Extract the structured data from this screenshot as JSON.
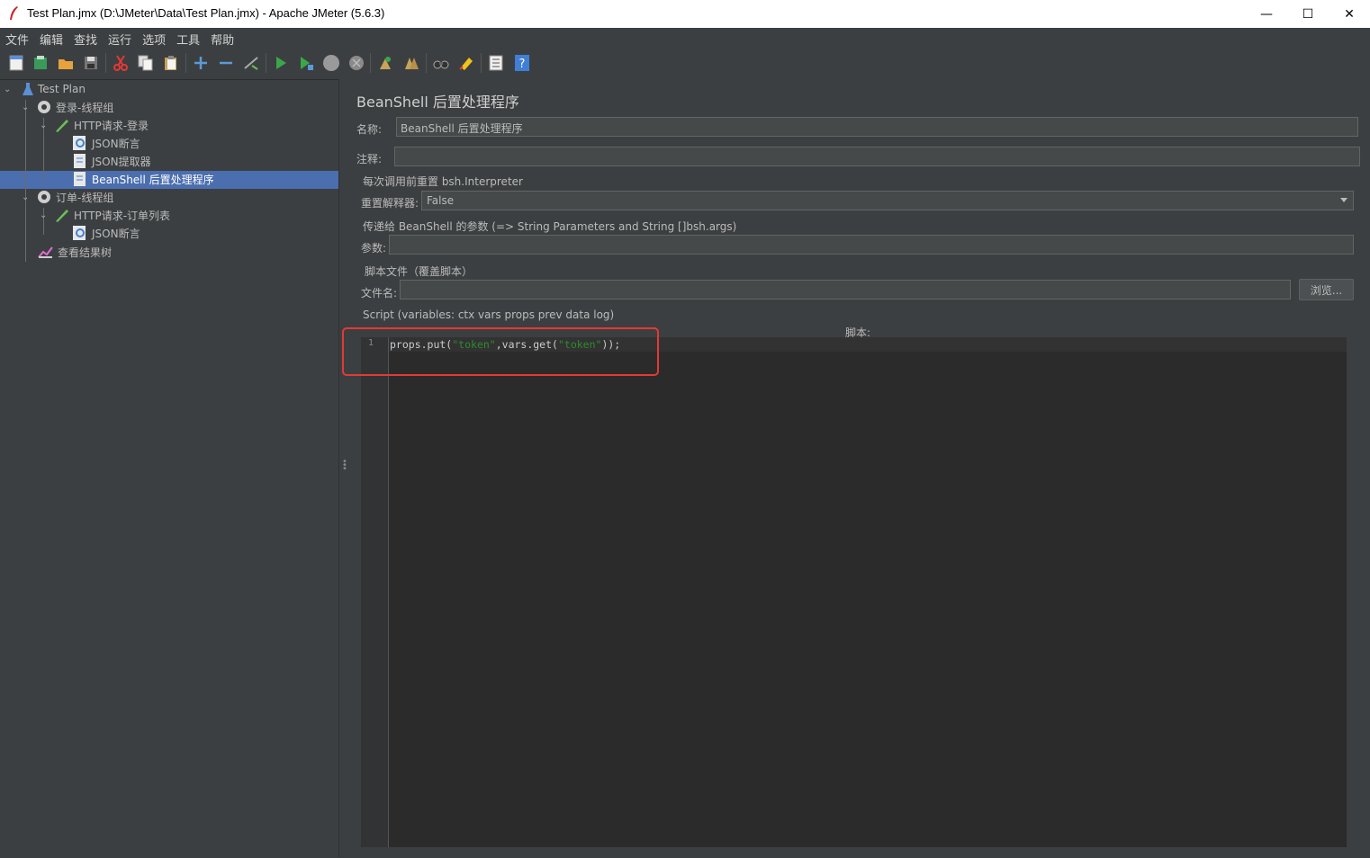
{
  "window": {
    "title": "Test Plan.jmx (D:\\JMeter\\Data\\Test Plan.jmx) - Apache JMeter (5.6.3)",
    "minimize": "—",
    "maximize": "☐",
    "close": "✕"
  },
  "menu": [
    "文件",
    "编辑",
    "查找",
    "运行",
    "选项",
    "工具",
    "帮助"
  ],
  "tree": {
    "test_plan": "Test Plan",
    "login_group": "登录-线程组",
    "http_login": "HTTP请求-登录",
    "json_assert_1": "JSON断言",
    "json_extractor": "JSON提取器",
    "beanshell": "BeanShell 后置处理程序",
    "order_group": "订单-线程组",
    "http_orders": "HTTP请求-订单列表",
    "json_assert_2": "JSON断言",
    "result_tree": "查看结果树"
  },
  "panel": {
    "heading": "BeanShell 后置处理程序",
    "name_label": "名称:",
    "name_value": "BeanShell 后置处理程序",
    "comment_label": "注释:",
    "comment_value": "",
    "reset_group": "每次调用前重置 bsh.Interpreter",
    "reset_label": "重置解释器:",
    "reset_value": "False",
    "params_group": "传递给 BeanShell 的参数 (=> String Parameters and String []bsh.args)",
    "params_label": "参数:",
    "params_value": "",
    "file_group": "脚本文件（覆盖脚本）",
    "file_label": "文件名:",
    "file_value": "",
    "browse_button": "浏览...",
    "script_group": "Script (variables: ctx vars props prev data log)",
    "script_label": "脚本:"
  },
  "editor": {
    "line_number": "1",
    "code_1": "props.put(",
    "str_1": "\"token\"",
    "code_2": ",vars.get(",
    "str_2": "\"token\"",
    "code_3": "));"
  },
  "colors": {
    "background": "#3c3f41",
    "selection": "#4b6eaf",
    "editor_bg": "#2b2b2b",
    "string": "#2e8b2e",
    "annotation": "#e53935"
  }
}
